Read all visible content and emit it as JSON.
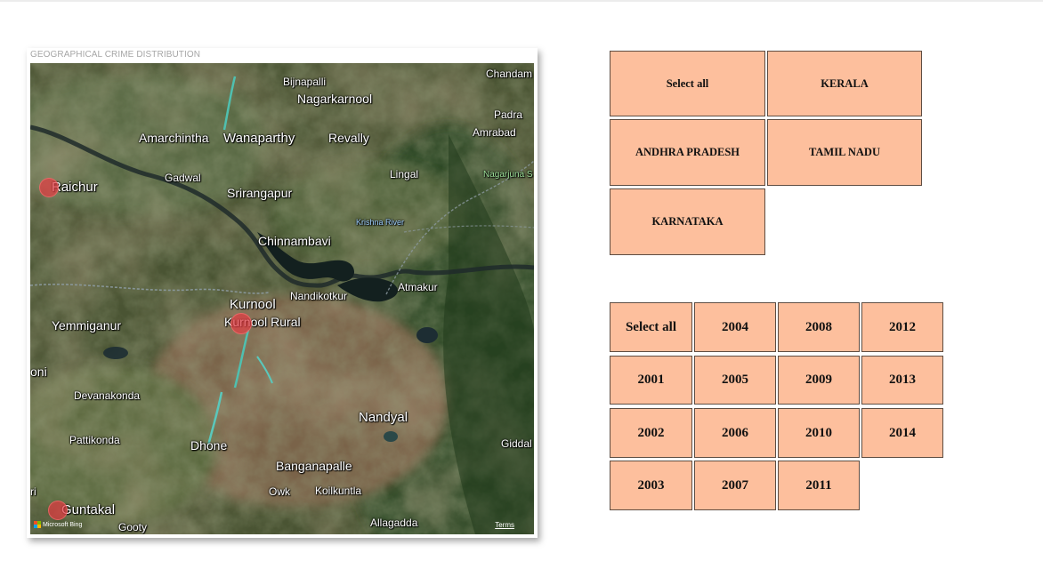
{
  "map": {
    "title": "GEOGRAPHICAL CRIME DISTRIBUTION",
    "places": {
      "bijnapalli": "Bijnapalli",
      "nagarkarnool": "Nagarkarnool",
      "chandam": "Chandam",
      "padra": "Padra",
      "amrabad": "Amrabad",
      "amarchintha": "Amarchintha",
      "wanaparthy": "Wanaparthy",
      "revally": "Revally",
      "raichur": "Raichur",
      "gadwal": "Gadwal",
      "srirangapur": "Srirangapur",
      "lingal": "Lingal",
      "nagarjuna": "Nagarjuna S",
      "krishna_river": "Krishna River",
      "chinnambavi": "Chinnambavi",
      "atmakur": "Atmakur",
      "nandikotkur": "Nandikotkur",
      "kurnool": "Kurnool",
      "kurnool_rural": "Kurnool Rural",
      "yemmiganur": "Yemmiganur",
      "oni": "oni",
      "devanakonda": "Devanakonda",
      "nandyal": "Nandyal",
      "pattikonda": "Pattikonda",
      "dhone": "Dhone",
      "giddal": "Giddal",
      "banganapalle": "Banganapalle",
      "owk": "Owk",
      "koilkuntla": "Koilkuntla",
      "ri": "ri",
      "guntakal": "Guntakal",
      "allagadda": "Allagadda",
      "gooty": "Gooty"
    },
    "attribution": "Microsoft Bing",
    "terms": "Terms",
    "bubble_color": "#e23c43"
  },
  "state_slicer": {
    "items": [
      "Select all",
      "KERALA",
      "ANDHRA PRADESH",
      "TAMIL NADU",
      "KARNATAKA"
    ],
    "tile_color": "#fdbf9d"
  },
  "year_slicer": {
    "items": [
      "Select all",
      "2004",
      "2008",
      "2012",
      "2001",
      "2005",
      "2009",
      "2013",
      "2002",
      "2006",
      "2010",
      "2014",
      "2003",
      "2007",
      "2011"
    ],
    "tile_color": "#fdbf9d"
  }
}
